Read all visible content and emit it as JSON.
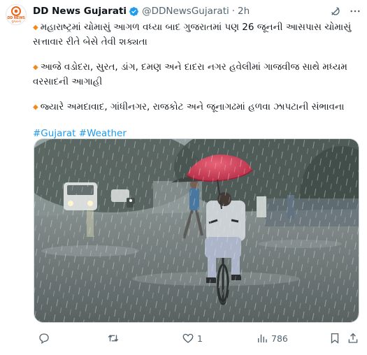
{
  "tweet": {
    "author_name": "DD News Gujarati",
    "handle": "@DDNewsGujarati",
    "separator": "·",
    "time": "2h",
    "avatar": {
      "brand": "DD NEWS",
      "sub": "ગુજરાતી",
      "color": "#e8671b"
    },
    "paragraphs": [
      "મહારાષ્ટ્રમાં ચોમાસું આગળ વધ્યા બાદ ગુજરાતમાં પણ 26 જૂનની આસપાસ ચોમાસું સત્તાવાર રીતે બેસે તેવી શક્યતા",
      "આજે વડોદરા, સુરત, ડાંગ, દમણ અને દાદરા નગર હવેલીમાં ગાજવીજ સાથે મધ્યમ વરસાદની આગાહી",
      "જ્યારે અમદાવાદ, ગાંધીનગર, રાજકોટ અને જૂનાગઢમાં હળવા ઝાપટાની સંભાવના"
    ],
    "bullet_glyph": "◆",
    "hashtags": [
      "#Gujarat",
      "#Weather"
    ],
    "actions": {
      "reply_count": "",
      "retweet_count": "",
      "like_count": "1",
      "views_count": "786"
    }
  },
  "icons": {
    "header": [
      "grok-icon",
      "more-options-icon"
    ],
    "actions": [
      "reply-icon",
      "retweet-icon",
      "like-icon",
      "views-icon",
      "bookmark-icon",
      "share-icon"
    ]
  },
  "colors": {
    "text": "#0f1419",
    "secondary": "#536471",
    "link": "#1d9bf0",
    "bullet": "#f18a1b",
    "verified": "#1d9bf0",
    "umbrella": "#d8324f"
  }
}
